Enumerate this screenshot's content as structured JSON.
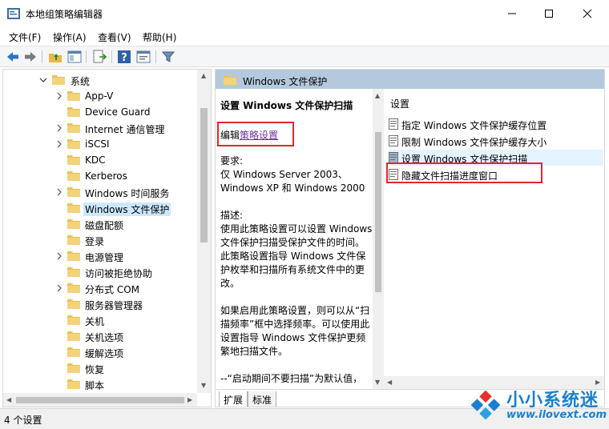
{
  "window": {
    "title": "本地组策略编辑器"
  },
  "menu": [
    "文件(F)",
    "操作(A)",
    "查看(V)",
    "帮助(H)"
  ],
  "tree": {
    "root": "系统",
    "items": [
      {
        "label": "App-V",
        "expandable": true
      },
      {
        "label": "Device Guard",
        "expandable": false
      },
      {
        "label": "Internet 通信管理",
        "expandable": true
      },
      {
        "label": "iSCSI",
        "expandable": true
      },
      {
        "label": "KDC",
        "expandable": false
      },
      {
        "label": "Kerberos",
        "expandable": false
      },
      {
        "label": "Windows 时间服务",
        "expandable": true
      },
      {
        "label": "Windows 文件保护",
        "expandable": false,
        "selected": true
      },
      {
        "label": "磁盘配额",
        "expandable": false
      },
      {
        "label": "登录",
        "expandable": false
      },
      {
        "label": "电源管理",
        "expandable": true
      },
      {
        "label": "访问被拒绝协助",
        "expandable": false
      },
      {
        "label": "分布式 COM",
        "expandable": true
      },
      {
        "label": "服务器管理器",
        "expandable": false
      },
      {
        "label": "关机",
        "expandable": false
      },
      {
        "label": "关机选项",
        "expandable": false
      },
      {
        "label": "缓解选项",
        "expandable": false
      },
      {
        "label": "恢复",
        "expandable": false
      },
      {
        "label": "脚本",
        "expandable": false
      }
    ]
  },
  "right": {
    "header": "Windows 文件保护",
    "description": {
      "heading": "设置 Windows 文件保护扫描",
      "edit_prefix": "编辑",
      "edit_link": "策略设置",
      "body": "要求:\n仅 Windows Server 2003、Windows XP 和 Windows 2000\n\n描述:\n使用此策略设置可以设置 Windows 文件保护扫描受保护文件的时间。此策略设置指导 Windows 文件保护枚举和扫描所有系统文件中的更改。\n\n如果启用此策略设置，则可以从“扫描频率”框中选择频率。可以使用此设置指导 Windows 文件保护更频繁地扫描文件。\n\n--“启动期间不要扫描”为默认值，"
    },
    "list": {
      "column_header": "设置",
      "items": [
        {
          "label": "指定 Windows 文件保护缓存位置"
        },
        {
          "label": "限制 Windows 文件保护缓存大小"
        },
        {
          "label": "设置 Windows 文件保护扫描",
          "selected": true
        },
        {
          "label": "隐藏文件扫描进度窗口"
        }
      ]
    },
    "tabs": [
      "扩展",
      "标准"
    ]
  },
  "status": "4 个设置",
  "watermark": {
    "brand": "小小系统迷",
    "url": "www.ilovext.com"
  },
  "colors": {
    "header_bg": "#b4c9de",
    "selection": "#cce8ff",
    "highlight_box": "#e0282e",
    "link": "#6b2f9e"
  }
}
